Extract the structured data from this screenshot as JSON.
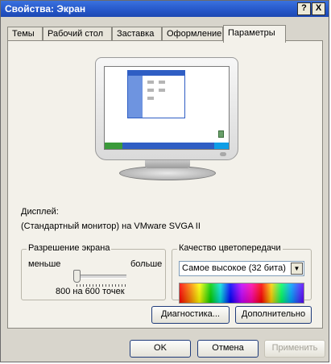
{
  "window": {
    "title": "Свойства: Экран",
    "help_label": "?",
    "close_label": "X"
  },
  "tabs": [
    {
      "label": "Темы"
    },
    {
      "label": "Рабочий стол"
    },
    {
      "label": "Заставка"
    },
    {
      "label": "Оформление"
    },
    {
      "label": "Параметры"
    }
  ],
  "display": {
    "label": "Дисплей:",
    "value": "(Стандартный монитор) на VMware SVGA II"
  },
  "resolution": {
    "title": "Разрешение экрана",
    "less_label": "меньше",
    "more_label": "больше",
    "value_text": "800 на 600 точек",
    "slider_level": 0.0
  },
  "color_quality": {
    "title": "Качество цветопередачи",
    "selected": "Самое высокое (32 бита)"
  },
  "buttons": {
    "troubleshoot": "Диагностика...",
    "advanced": "Дополнительно",
    "ok": "OK",
    "cancel": "Отмена",
    "apply": "Применить"
  },
  "colors": {
    "titlebar": "#2556c8",
    "panel": "#f3f1ea",
    "window": "#d8d5cc"
  },
  "icons": {
    "dropdown": "▼"
  }
}
